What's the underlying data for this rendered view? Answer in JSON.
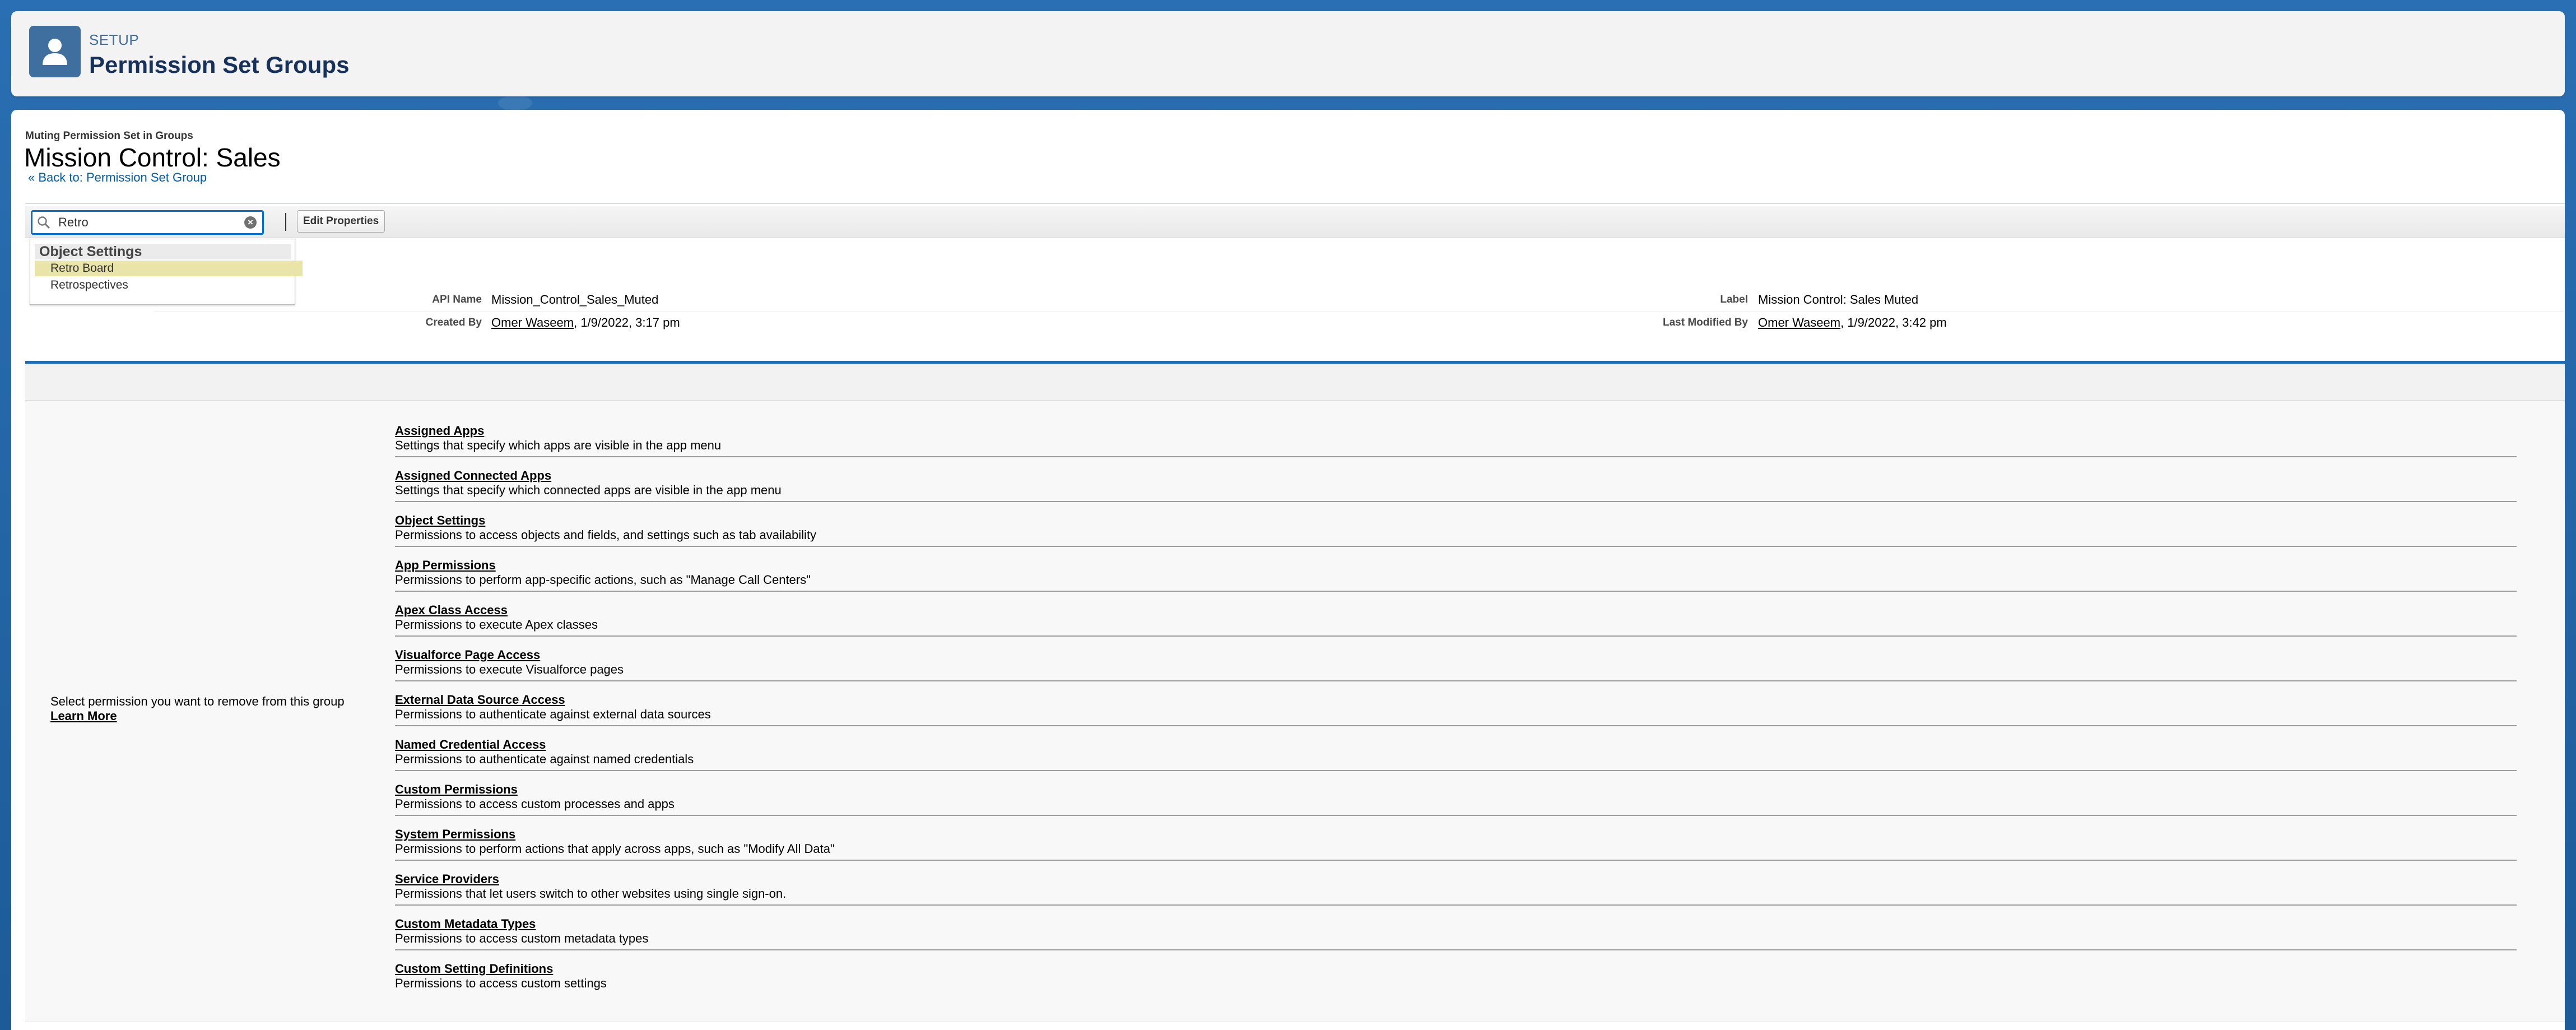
{
  "header": {
    "eyebrow": "SETUP",
    "title": "Permission Set Groups",
    "icon": "user-icon"
  },
  "page": {
    "eyebrow": "Muting Permission Set in Groups",
    "title": "Mission Control: Sales",
    "back_link": "« Back to: Permission Set Group"
  },
  "toolbar": {
    "search_value": "Retro",
    "edit_label": "Edit Properties"
  },
  "suggestions": {
    "group": "Object Settings",
    "items": [
      "Retro Board",
      "Retrospectives"
    ],
    "highlighted_index": 0
  },
  "details": {
    "api_name_label": "API Name",
    "api_name_value": "Mission_Control_Sales_Muted",
    "label_label": "Label",
    "label_value": "Mission Control: Sales Muted",
    "created_by_label": "Created By",
    "created_by_user": "Omer Waseem",
    "created_by_date": ", 1/9/2022, 3:17 pm",
    "modified_by_label": "Last Modified By",
    "modified_by_user": "Omer Waseem",
    "modified_by_date": ", 1/9/2022, 3:42 pm"
  },
  "instructions": {
    "text": "Select permission you want to remove from this group",
    "learn_more": "Learn More"
  },
  "permissions": [
    {
      "title": "Assigned Apps",
      "desc": "Settings that specify which apps are visible in the app menu"
    },
    {
      "title": "Assigned Connected Apps",
      "desc": "Settings that specify which connected apps are visible in the app menu"
    },
    {
      "title": "Object Settings",
      "desc": "Permissions to access objects and fields, and settings such as tab availability"
    },
    {
      "title": "App Permissions",
      "desc": "Permissions to perform app-specific actions, such as \"Manage Call Centers\""
    },
    {
      "title": "Apex Class Access",
      "desc": "Permissions to execute Apex classes"
    },
    {
      "title": "Visualforce Page Access",
      "desc": "Permissions to execute Visualforce pages"
    },
    {
      "title": "External Data Source Access",
      "desc": "Permissions to authenticate against external data sources"
    },
    {
      "title": "Named Credential Access",
      "desc": "Permissions to authenticate against named credentials"
    },
    {
      "title": "Custom Permissions",
      "desc": "Permissions to access custom processes and apps"
    },
    {
      "title": "System Permissions",
      "desc": "Permissions to perform actions that apply across apps, such as \"Modify All Data\""
    },
    {
      "title": "Service Providers",
      "desc": "Permissions that let users switch to other websites using single sign-on."
    },
    {
      "title": "Custom Metadata Types",
      "desc": "Permissions to access custom metadata types"
    },
    {
      "title": "Custom Setting Definitions",
      "desc": "Permissions to access custom settings"
    }
  ]
}
